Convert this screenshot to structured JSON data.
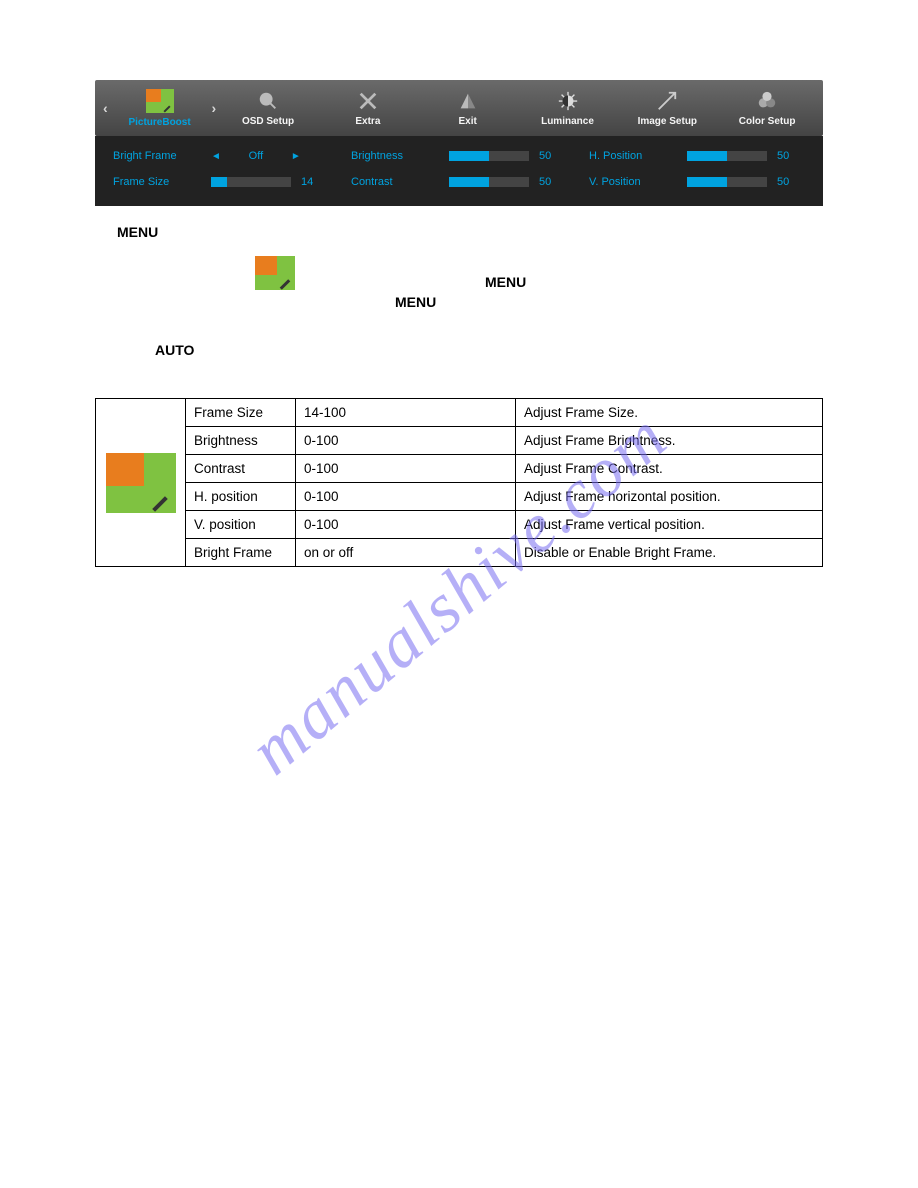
{
  "watermark": "manualshive.com",
  "osd": {
    "tabs": [
      {
        "label": "PictureBoost",
        "icon": "pictureboost-icon",
        "active": true
      },
      {
        "label": "OSD Setup",
        "icon": "osd-setup-icon"
      },
      {
        "label": "Extra",
        "icon": "extra-icon"
      },
      {
        "label": "Exit",
        "icon": "exit-icon"
      },
      {
        "label": "Luminance",
        "icon": "luminance-icon"
      },
      {
        "label": "Image Setup",
        "icon": "image-setup-icon"
      },
      {
        "label": "Color Setup",
        "icon": "color-setup-icon"
      }
    ],
    "arrows": {
      "left": "‹",
      "right": "›"
    }
  },
  "settings": {
    "bright_frame": {
      "label": "Bright Frame",
      "value": "Off"
    },
    "frame_size": {
      "label": "Frame Size",
      "value": "14",
      "fill": 14
    },
    "brightness": {
      "label": "Brightness",
      "value": "50",
      "fill": 50
    },
    "contrast": {
      "label": "Contrast",
      "value": "50",
      "fill": 50
    },
    "h_position": {
      "label": "H. Position",
      "value": "50",
      "fill": 50
    },
    "v_position": {
      "label": "V. Position",
      "value": "50",
      "fill": 50
    }
  },
  "body": {
    "menu1": "MENU",
    "menu2": "MENU",
    "menu3": "MENU",
    "auto": "AUTO"
  },
  "table": {
    "rows": [
      {
        "name": "Frame Size",
        "range": "14-100",
        "desc": "Adjust Frame Size."
      },
      {
        "name": "Brightness",
        "range": "0-100",
        "desc": "Adjust Frame Brightness."
      },
      {
        "name": "Contrast",
        "range": "0-100",
        "desc": "Adjust Frame Contrast."
      },
      {
        "name": "H. position",
        "range": "0-100",
        "desc": "Adjust Frame horizontal position."
      },
      {
        "name": "V. position",
        "range": "0-100",
        "desc": "Adjust Frame vertical position."
      },
      {
        "name": "Bright Frame",
        "range": "on or off",
        "desc": "Disable or Enable Bright Frame."
      }
    ]
  }
}
